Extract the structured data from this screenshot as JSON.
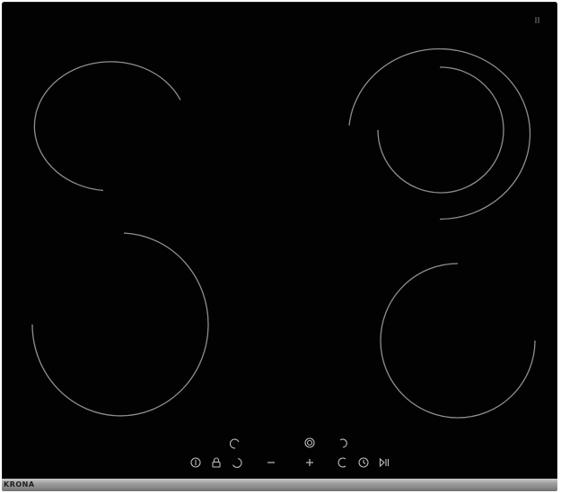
{
  "brand": "KRONA",
  "colors": {
    "glass": "#020202",
    "ring_line": "#8e8e8e",
    "control_icon": "#bdbdbd",
    "trim": "#9c9c9c"
  },
  "cooking_zones": [
    {
      "name": "rear-left-zone",
      "rings": 1
    },
    {
      "name": "rear-right-zone",
      "rings": 2
    },
    {
      "name": "front-left-zone",
      "rings": 1
    },
    {
      "name": "front-right-zone",
      "rings": 1
    }
  ],
  "controls": [
    {
      "name": "power-icon",
      "icon": "power"
    },
    {
      "name": "lock-icon",
      "icon": "lock"
    },
    {
      "name": "zone-select-icon",
      "icon": "zone-select"
    },
    {
      "name": "minus-icon",
      "icon": "minus"
    },
    {
      "name": "plus-icon",
      "icon": "plus"
    },
    {
      "name": "zone-select-icon",
      "icon": "zone-select"
    },
    {
      "name": "timer-icon",
      "icon": "timer"
    },
    {
      "name": "pause-icon",
      "icon": "pause"
    }
  ]
}
